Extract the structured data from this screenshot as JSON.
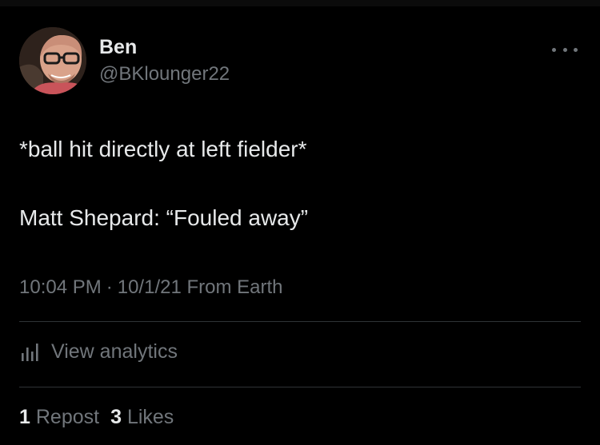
{
  "author": {
    "display_name": "Ben",
    "handle": "@BKlounger22"
  },
  "tweet": {
    "lines": [
      "*ball hit directly at left fielder*",
      "Matt Shepard: “Fouled away”"
    ],
    "time": "10:04 PM",
    "separator": "·",
    "date": "10/1/21",
    "source": "From Earth"
  },
  "analytics": {
    "label": "View analytics",
    "icon": "bar-chart-icon"
  },
  "stats": {
    "reposts_count": "1",
    "reposts_label": "Repost",
    "likes_count": "3",
    "likes_label": "Likes"
  },
  "colors": {
    "background": "#000000",
    "primary_text": "#e7e9ea",
    "secondary_text": "#71767b",
    "divider": "#2f3336"
  }
}
